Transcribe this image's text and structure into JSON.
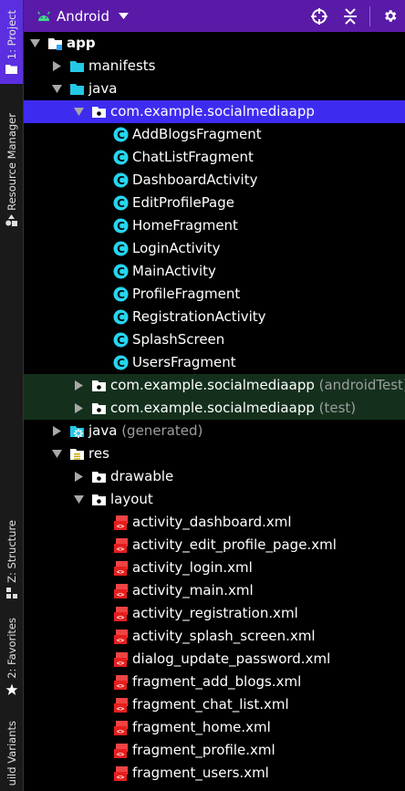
{
  "toolstrip": {
    "project": "1: Project",
    "resource_manager": "Resource Manager",
    "structure": "Z: Structure",
    "favorites": "2: Favorites",
    "build_variants": "uild Variants"
  },
  "header": {
    "view_label": "Android",
    "icons": [
      "android-icon",
      "chevron-down-icon",
      "crosshair-icon",
      "collapse-all-icon",
      "gear-icon"
    ],
    "accent_color": "#5a1aa8"
  },
  "tree": {
    "rows": [
      {
        "label": "app",
        "suffix": "",
        "icon": "module-folder-icon",
        "expanded": true,
        "has_arrow": true
      },
      {
        "label": "manifests",
        "suffix": "",
        "icon": "folder-icon",
        "expanded": false,
        "has_arrow": true
      },
      {
        "label": "java",
        "suffix": "",
        "icon": "folder-icon",
        "expanded": true,
        "has_arrow": true
      },
      {
        "label": "com.example.socialmediaapp",
        "suffix": "",
        "icon": "package-icon",
        "expanded": true,
        "has_arrow": true,
        "selected": true
      },
      {
        "label": "AddBlogsFragment",
        "suffix": "",
        "icon": "class-icon",
        "has_arrow": false
      },
      {
        "label": "ChatListFragment",
        "suffix": "",
        "icon": "class-icon",
        "has_arrow": false
      },
      {
        "label": "DashboardActivity",
        "suffix": "",
        "icon": "class-icon",
        "has_arrow": false
      },
      {
        "label": "EditProfilePage",
        "suffix": "",
        "icon": "class-icon",
        "has_arrow": false
      },
      {
        "label": "HomeFragment",
        "suffix": "",
        "icon": "class-icon",
        "has_arrow": false
      },
      {
        "label": "LoginActivity",
        "suffix": "",
        "icon": "class-icon",
        "has_arrow": false
      },
      {
        "label": "MainActivity",
        "suffix": "",
        "icon": "class-icon",
        "has_arrow": false
      },
      {
        "label": "ProfileFragment",
        "suffix": "",
        "icon": "class-icon",
        "has_arrow": false
      },
      {
        "label": "RegistrationActivity",
        "suffix": "",
        "icon": "class-icon",
        "has_arrow": false
      },
      {
        "label": "SplashScreen",
        "suffix": "",
        "icon": "class-icon",
        "has_arrow": false
      },
      {
        "label": "UsersFragment",
        "suffix": "",
        "icon": "class-icon",
        "has_arrow": false
      },
      {
        "label": "com.example.socialmediaapp",
        "suffix": "(androidTest)",
        "icon": "package-icon",
        "expanded": false,
        "has_arrow": true,
        "highlight": true
      },
      {
        "label": "com.example.socialmediaapp",
        "suffix": "(test)",
        "icon": "package-icon",
        "expanded": false,
        "has_arrow": true,
        "highlight": true
      },
      {
        "label": "java",
        "suffix": "(generated)",
        "icon": "generated-folder-icon",
        "expanded": false,
        "has_arrow": true
      },
      {
        "label": "res",
        "suffix": "",
        "icon": "res-folder-icon",
        "expanded": true,
        "has_arrow": true
      },
      {
        "label": "drawable",
        "suffix": "",
        "icon": "package-icon",
        "expanded": false,
        "has_arrow": true
      },
      {
        "label": "layout",
        "suffix": "",
        "icon": "package-icon",
        "expanded": true,
        "has_arrow": true
      },
      {
        "label": "activity_dashboard.xml",
        "suffix": "",
        "icon": "xml-layout-icon",
        "has_arrow": false
      },
      {
        "label": "activity_edit_profile_page.xml",
        "suffix": "",
        "icon": "xml-layout-icon",
        "has_arrow": false
      },
      {
        "label": "activity_login.xml",
        "suffix": "",
        "icon": "xml-layout-icon",
        "has_arrow": false
      },
      {
        "label": "activity_main.xml",
        "suffix": "",
        "icon": "xml-layout-icon",
        "has_arrow": false
      },
      {
        "label": "activity_registration.xml",
        "suffix": "",
        "icon": "xml-layout-icon",
        "has_arrow": false
      },
      {
        "label": "activity_splash_screen.xml",
        "suffix": "",
        "icon": "xml-layout-icon",
        "has_arrow": false
      },
      {
        "label": "dialog_update_password.xml",
        "suffix": "",
        "icon": "xml-layout-icon",
        "has_arrow": false
      },
      {
        "label": "fragment_add_blogs.xml",
        "suffix": "",
        "icon": "xml-layout-icon",
        "has_arrow": false
      },
      {
        "label": "fragment_chat_list.xml",
        "suffix": "",
        "icon": "xml-layout-icon",
        "has_arrow": false
      },
      {
        "label": "fragment_home.xml",
        "suffix": "",
        "icon": "xml-layout-icon",
        "has_arrow": false
      },
      {
        "label": "fragment_profile.xml",
        "suffix": "",
        "icon": "xml-layout-icon",
        "has_arrow": false
      },
      {
        "label": "fragment_users.xml",
        "suffix": "",
        "icon": "xml-layout-icon",
        "has_arrow": false
      }
    ]
  }
}
